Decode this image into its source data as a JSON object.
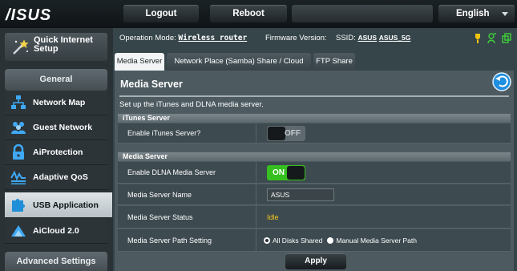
{
  "header": {
    "brand": "ASUS",
    "logout_label": "Logout",
    "reboot_label": "Reboot",
    "language": "English"
  },
  "sidebar": {
    "quick_setup_label": "Quick Internet Setup",
    "general_heading": "General",
    "general_items": [
      {
        "label": "Network Map",
        "icon": "network-map-icon"
      },
      {
        "label": "Guest Network",
        "icon": "guest-network-icon"
      },
      {
        "label": "AiProtection",
        "icon": "lock-icon"
      },
      {
        "label": "Adaptive QoS",
        "icon": "qos-icon"
      },
      {
        "label": "USB Application",
        "icon": "puzzle-icon",
        "active": true
      },
      {
        "label": "AiCloud 2.0",
        "icon": "cloud-icon"
      }
    ],
    "advanced_heading": "Advanced Settings"
  },
  "status_bar": {
    "operation_mode_label": "Operation Mode:",
    "operation_mode_value": "Wireless router",
    "firmware_label": "Firmware Version:",
    "ssid_label": "SSID:",
    "ssid_values": [
      "ASUS",
      "ASUS_5G"
    ],
    "icons": [
      "usb-indicator-icon",
      "user-icon",
      "copy-icon",
      "usb-icon",
      "printer-icon"
    ],
    "icon_colors": {
      "yellow": "#f1c40f",
      "green": "#3ed13a"
    }
  },
  "tabs": [
    {
      "label": "Media Server",
      "active": true
    },
    {
      "label": "Network Place (Samba) Share / Cloud Disk",
      "active": false
    },
    {
      "label": "FTP Share",
      "active": false
    }
  ],
  "panel": {
    "title": "Media Server",
    "description": "Set up the iTunes and DLNA media server.",
    "itunes_section": "iTunes Server",
    "itunes_label": "Enable iTunes Server?",
    "itunes_toggle": "OFF",
    "media_section": "Media Server",
    "dlna_label": "Enable DLNA Media Server",
    "dlna_toggle": "ON",
    "name_label": "Media Server Name",
    "name_value": "ASUS",
    "status_label": "Media Server Status",
    "status_value": "Idle",
    "path_label": "Media Server Path Setting",
    "path_options": [
      "All Disks Shared",
      "Manual Media Server Path"
    ],
    "path_selected": "All Disks Shared",
    "apply_label": "Apply"
  }
}
